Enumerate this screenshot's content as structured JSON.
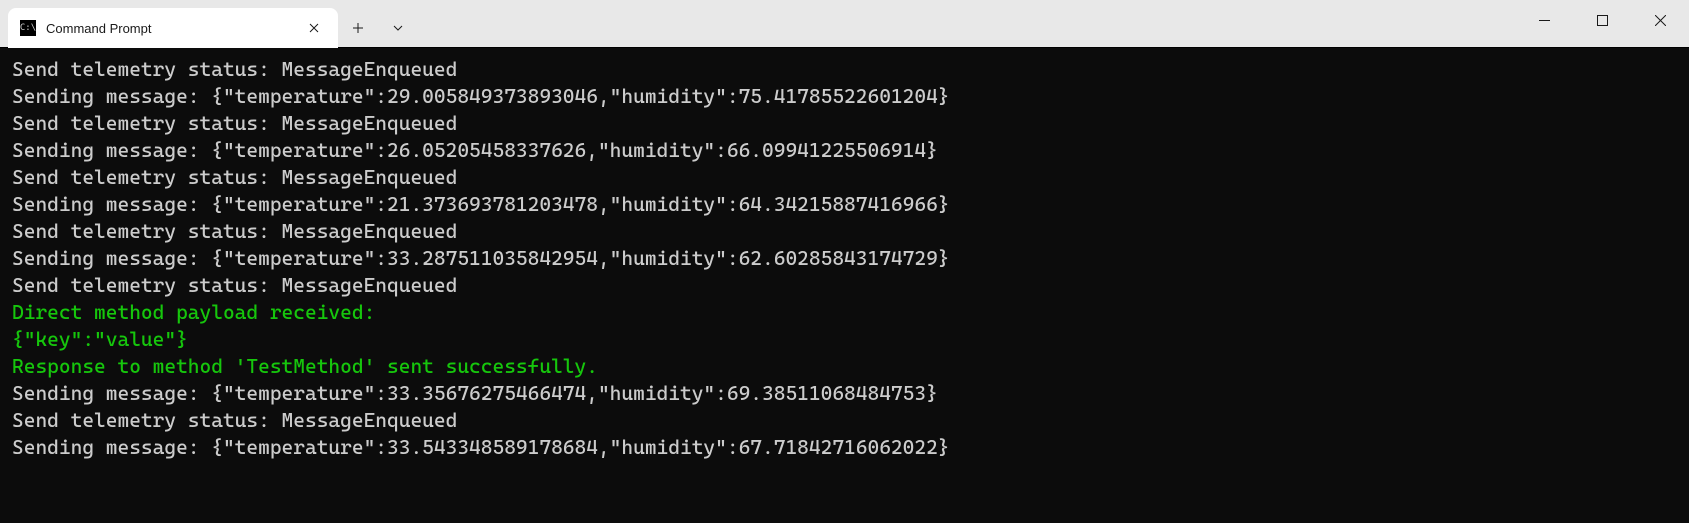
{
  "window": {
    "tab_title": "Command Prompt"
  },
  "terminal": {
    "lines": [
      {
        "text": "Send telemetry status: MessageEnqueued",
        "cls": ""
      },
      {
        "text": "Sending message: {\"temperature\":29.005849373893046,\"humidity\":75.41785522601204}",
        "cls": ""
      },
      {
        "text": "Send telemetry status: MessageEnqueued",
        "cls": ""
      },
      {
        "text": "Sending message: {\"temperature\":26.05205458337626,\"humidity\":66.09941225506914}",
        "cls": ""
      },
      {
        "text": "Send telemetry status: MessageEnqueued",
        "cls": ""
      },
      {
        "text": "Sending message: {\"temperature\":21.373693781203478,\"humidity\":64.34215887416966}",
        "cls": ""
      },
      {
        "text": "Send telemetry status: MessageEnqueued",
        "cls": ""
      },
      {
        "text": "Sending message: {\"temperature\":33.287511035842954,\"humidity\":62.60285843174729}",
        "cls": ""
      },
      {
        "text": "Send telemetry status: MessageEnqueued",
        "cls": ""
      },
      {
        "text": "Direct method payload received:",
        "cls": "green"
      },
      {
        "text": "{\"key\":\"value\"}",
        "cls": "green"
      },
      {
        "text": "Response to method 'TestMethod' sent successfully.",
        "cls": "green"
      },
      {
        "text": "Sending message: {\"temperature\":33.35676275466474,\"humidity\":69.38511068484753}",
        "cls": ""
      },
      {
        "text": "Send telemetry status: MessageEnqueued",
        "cls": ""
      },
      {
        "text": "Sending message: {\"temperature\":33.543348589178684,\"humidity\":67.71842716062022}",
        "cls": ""
      }
    ]
  }
}
